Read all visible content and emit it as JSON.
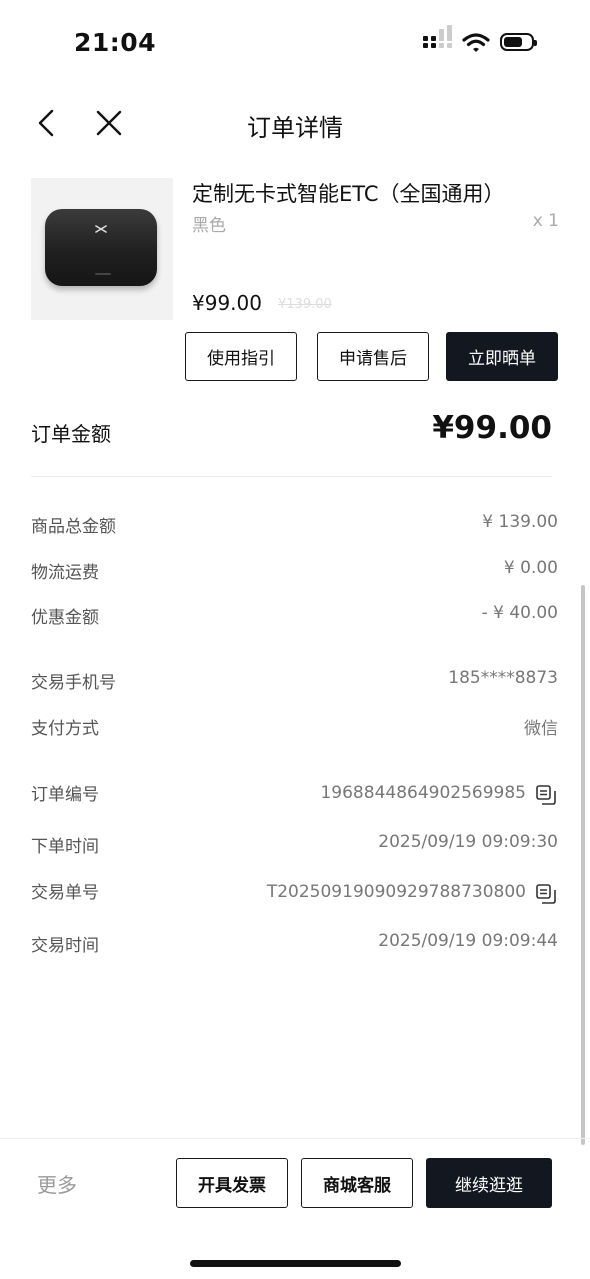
{
  "status_bar": {
    "time": "21:04"
  },
  "nav": {
    "title": "订单详情"
  },
  "product": {
    "name": "定制无卡式智能ETC（全国通用）",
    "variant": "黑色",
    "quantity": "x 1",
    "price": "¥99.00",
    "original_price": "¥139.00"
  },
  "item_actions": {
    "guide": "使用指引",
    "after_sales": "申请售后",
    "share": "立即晒单"
  },
  "order_total": {
    "label": "订单金额",
    "value": "¥99.00"
  },
  "details": {
    "goods_total_label": "商品总金额",
    "goods_total_value": "¥ 139.00",
    "shipping_label": "物流运费",
    "shipping_value": "¥ 0.00",
    "discount_label": "优惠金额",
    "discount_value": "- ¥ 40.00",
    "phone_label": "交易手机号",
    "phone_value": "185****8873",
    "payment_label": "支付方式",
    "payment_value": "微信",
    "order_no_label": "订单编号",
    "order_no_value": "1968844864902569985",
    "order_time_label": "下单时间",
    "order_time_value": "2025/09/19 09:09:30",
    "trade_no_label": "交易单号",
    "trade_no_value": "T2025091909092978873080​0",
    "trade_time_label": "交易时间",
    "trade_time_value": "2025/09/19 09:09:44"
  },
  "bottom_bar": {
    "more": "更多",
    "invoice": "开具发票",
    "service": "商城客服",
    "continue": "继续逛逛"
  },
  "colors": {
    "dark_button": "#131820",
    "muted_text": "#777777"
  }
}
